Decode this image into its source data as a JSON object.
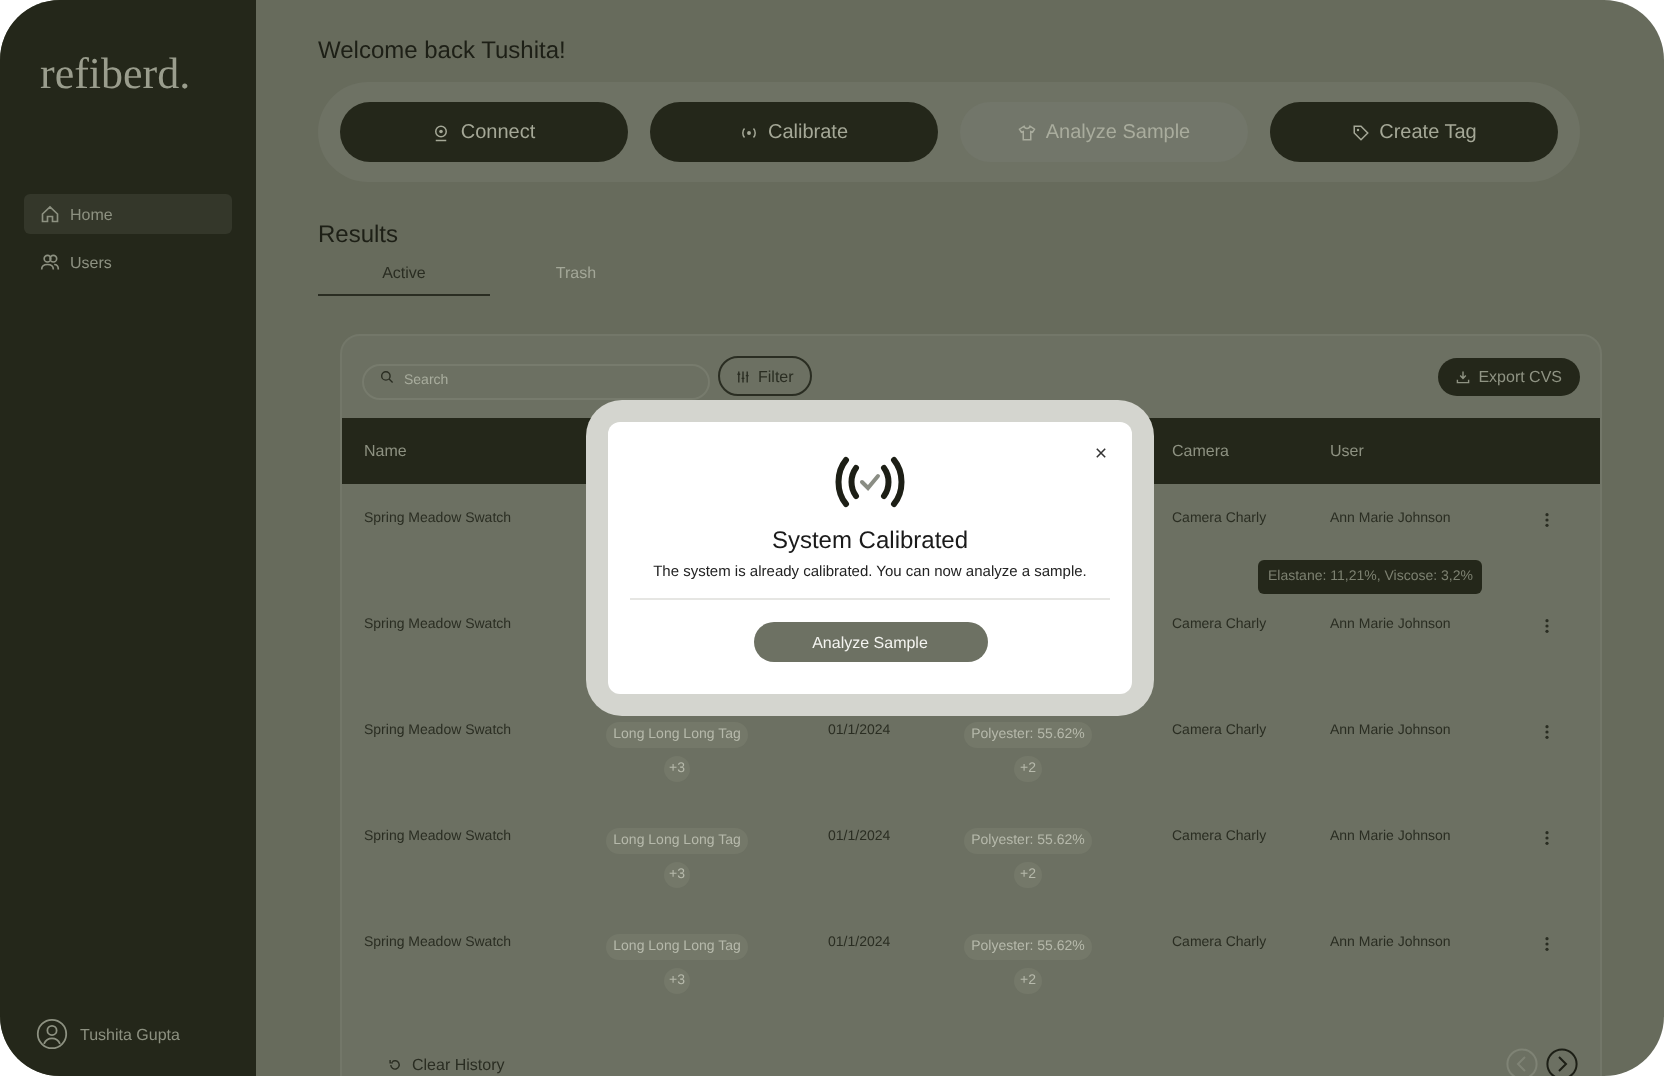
{
  "sidebar": {
    "logo": "refiberd.",
    "items": [
      {
        "label": "Home",
        "selected": true
      },
      {
        "label": "Users",
        "selected": false
      }
    ],
    "user": "Tushita Gupta"
  },
  "greeting": "Welcome back Tushita!",
  "actions": [
    {
      "label": "Connect",
      "disabled": false
    },
    {
      "label": "Calibrate",
      "disabled": false
    },
    {
      "label": "Analyze Sample",
      "disabled": true
    },
    {
      "label": "Create Tag",
      "disabled": false
    }
  ],
  "results": {
    "title": "Results",
    "tabs": [
      {
        "label": "Active",
        "selected": true
      },
      {
        "label": "Trash",
        "selected": false
      }
    ]
  },
  "table": {
    "search": {
      "placeholder": "Search"
    },
    "filter": "Filter",
    "export": "Export CVS",
    "columns": [
      "Name",
      "Camera",
      "User"
    ],
    "rows": [
      {
        "name": "Spring Meadow Swatch",
        "camera": "Camera Charly",
        "user": "Ann Marie Johnson"
      },
      {
        "name": "Spring Meadow Swatch",
        "camera": "Camera Charly",
        "user": "Ann Marie Johnson"
      },
      {
        "name": "Spring Meadow Swatch",
        "tag": "Long Long Long Tag",
        "tag_more": "+3",
        "date": "01/1/2024",
        "composition": "Polyester: 55.62%",
        "composition_more": "+2",
        "camera": "Camera Charly",
        "user": "Ann Marie Johnson"
      },
      {
        "name": "Spring Meadow Swatch",
        "tag": "Long Long Long Tag",
        "tag_more": "+3",
        "date": "01/1/2024",
        "composition": "Polyester: 55.62%",
        "composition_more": "+2",
        "camera": "Camera Charly",
        "user": "Ann Marie Johnson"
      },
      {
        "name": "Spring Meadow Swatch",
        "tag": "Long Long Long Tag",
        "tag_more": "+3",
        "date": "01/1/2024",
        "composition": "Polyester: 55.62%",
        "composition_more": "+2",
        "camera": "Camera Charly",
        "user": "Ann Marie Johnson"
      }
    ],
    "tooltip": "Elastane: 11,21%, Viscose: 3,2%",
    "clear": "Clear History"
  },
  "dialog": {
    "title": "System Calibrated",
    "message": "The system is already calibrated. You can now analyze a sample.",
    "button": "Analyze Sample"
  }
}
